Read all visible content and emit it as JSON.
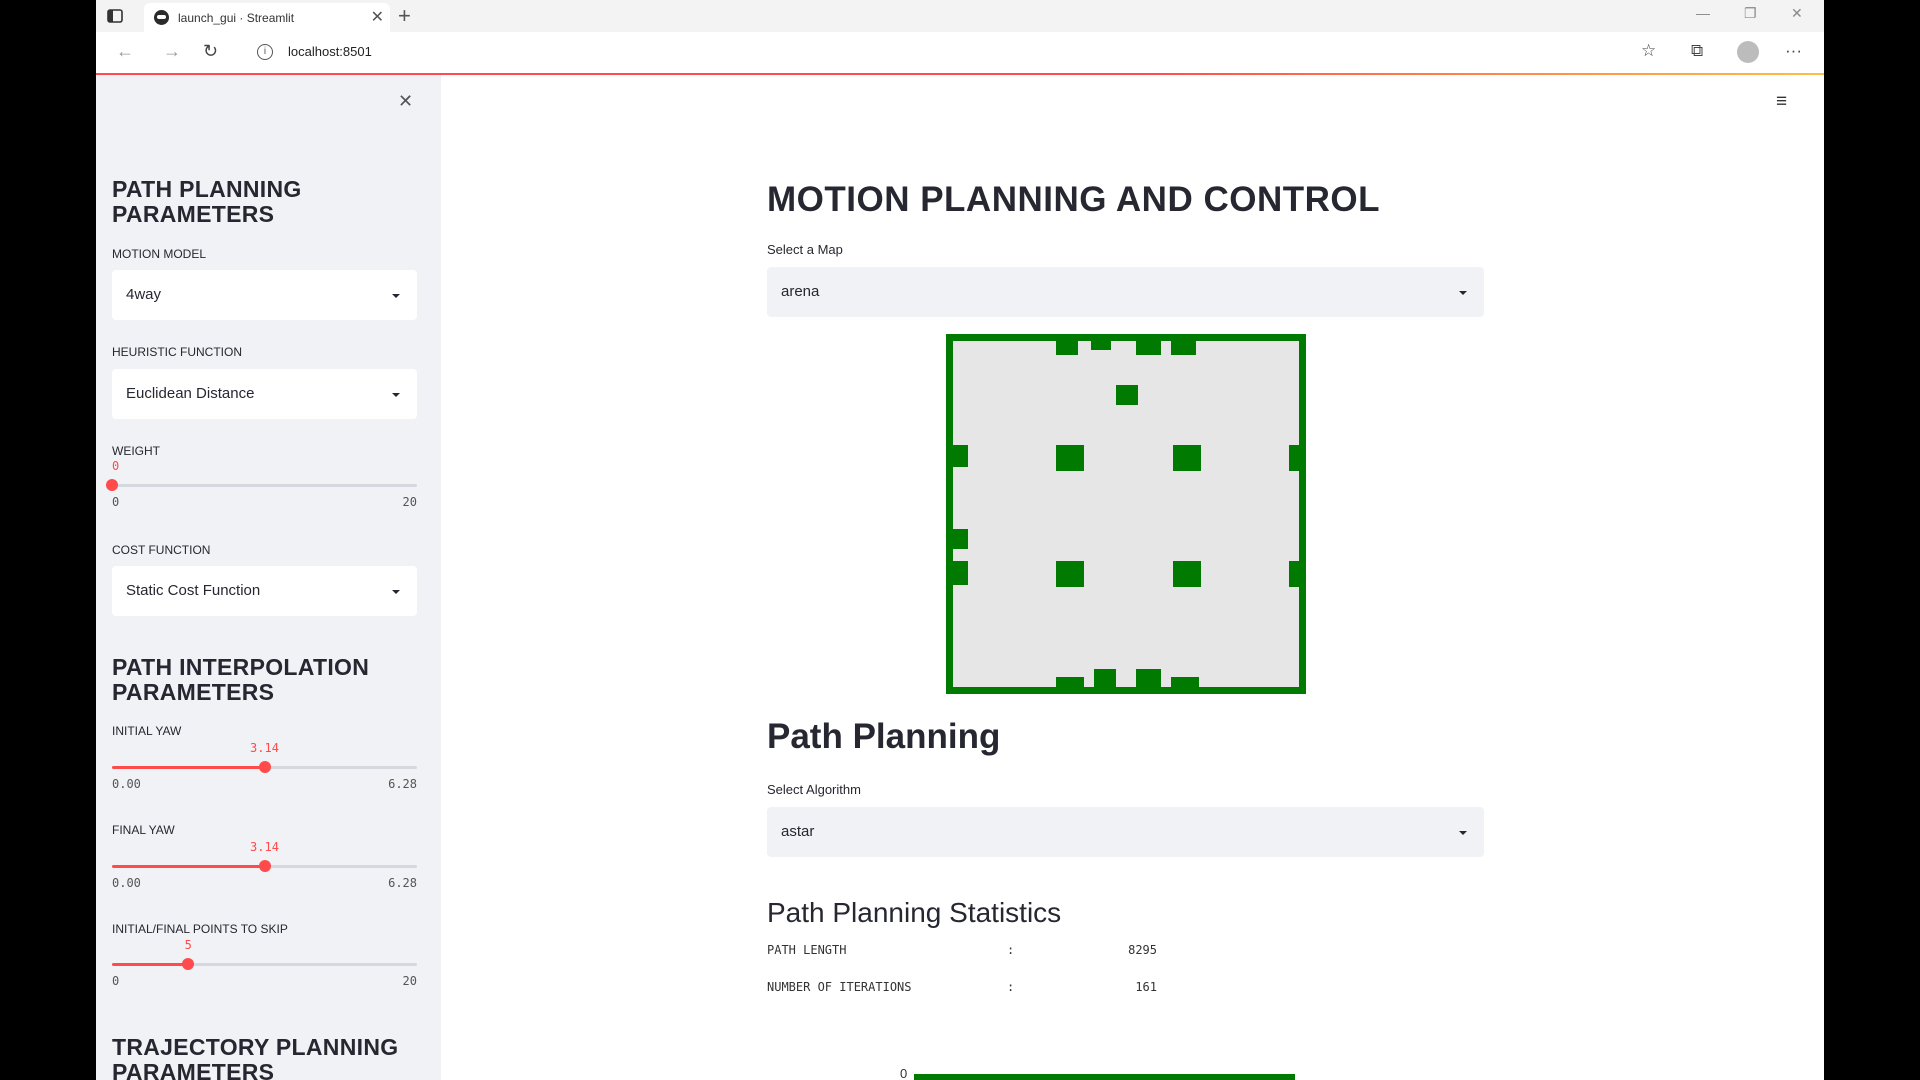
{
  "browser": {
    "tab_title": "launch_gui · Streamlit",
    "tab_close": "✕",
    "new_tab": "+",
    "url": "localhost:8501",
    "window_controls": [
      "—",
      "❐",
      "✕"
    ]
  },
  "sidebar": {
    "close": "✕",
    "path_planning": {
      "heading": "PATH PLANNING PARAMETERS",
      "motion_model": {
        "label": "MOTION MODEL",
        "value": "4way"
      },
      "heuristic": {
        "label": "HEURISTIC FUNCTION",
        "value": "Euclidean Distance"
      },
      "weight": {
        "label": "WEIGHT",
        "value": "0",
        "min": "0",
        "max": "20",
        "fraction": 0
      },
      "cost": {
        "label": "COST FUNCTION",
        "value": "Static Cost Function"
      }
    },
    "interpolation": {
      "heading": "PATH INTERPOLATION PARAMETERS",
      "initial_yaw": {
        "label": "INITIAL YAW",
        "value": "3.14",
        "min": "0.00",
        "max": "6.28",
        "fraction": 0.5
      },
      "final_yaw": {
        "label": "FINAL YAW",
        "value": "3.14",
        "min": "0.00",
        "max": "6.28",
        "fraction": 0.5
      },
      "skip": {
        "label": "INITIAL/FINAL POINTS TO SKIP",
        "value": "5",
        "min": "0",
        "max": "20",
        "fraction": 0.25
      }
    },
    "trajectory": {
      "heading": "TRAJECTORY PLANNING PARAMETERS"
    }
  },
  "main": {
    "menu": "≡",
    "title": "MOTION PLANNING AND CONTROL",
    "map_select": {
      "label": "Select a Map",
      "value": "arena"
    },
    "path_title": "Path Planning",
    "algo_select": {
      "label": "Select Algorithm",
      "value": "astar"
    },
    "stats": {
      "title": "Path Planning Statistics",
      "rows": [
        {
          "key": "PATH LENGTH",
          "sep": ":",
          "value": "8295"
        },
        {
          "key": "NUMBER OF ITERATIONS",
          "sep": ":",
          "value": "161"
        }
      ]
    },
    "plot_axis_zero": "0"
  },
  "colors": {
    "accent": "#ff4b4b",
    "map_wall": "#007a00",
    "map_floor": "#e6e6e6",
    "sidebar_bg": "#f0f2f6"
  }
}
